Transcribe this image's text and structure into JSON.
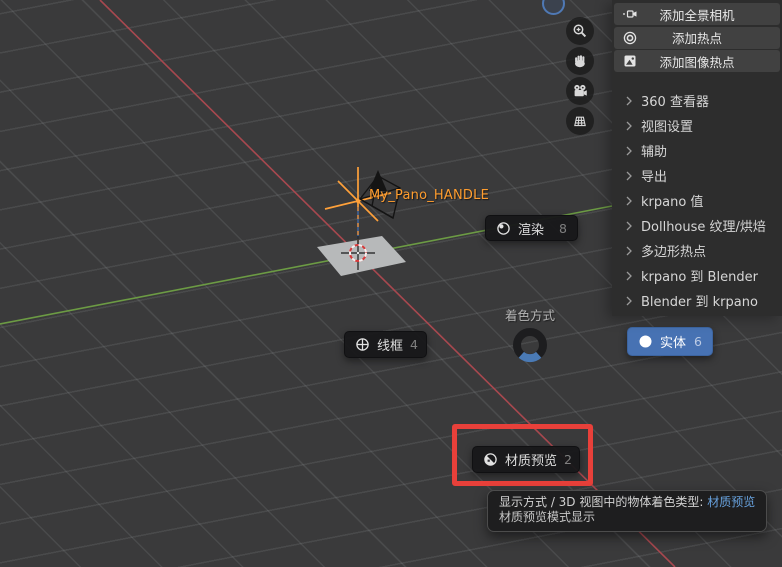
{
  "colors": {
    "accent_blue": "#4772b3",
    "annotation_red": "#e8403a",
    "object_orange": "#ff9d2e",
    "axis_red": "#a8484f",
    "axis_green": "#6c9b44"
  },
  "viewport": {
    "object_label": "My_Pano_HANDLE",
    "toolbar": [
      {
        "name": "zoom-in"
      },
      {
        "name": "pan"
      },
      {
        "name": "camera-view"
      },
      {
        "name": "toggle-orthographic"
      }
    ]
  },
  "pie_menu": {
    "title": "着色方式",
    "items": [
      {
        "label": "渲染",
        "shortcut": "8",
        "direction": "top"
      },
      {
        "label": "线框",
        "shortcut": "4",
        "direction": "left"
      },
      {
        "label": "实体",
        "shortcut": "6",
        "direction": "right",
        "selected": true
      },
      {
        "label": "材质预览",
        "shortcut": "2",
        "direction": "bottom",
        "annotated": true
      }
    ]
  },
  "panel": {
    "buttons": [
      {
        "label": "添加全景相机"
      },
      {
        "label": "添加热点"
      },
      {
        "label": "添加图像热点"
      }
    ],
    "sections": [
      {
        "label": "360 查看器"
      },
      {
        "label": "视图设置"
      },
      {
        "label": "辅助"
      },
      {
        "label": "导出"
      },
      {
        "label": "krpano 值"
      },
      {
        "label": "Dollhouse 纹理/烘焙"
      },
      {
        "label": "多边形热点"
      },
      {
        "label": "krpano 到 Blender"
      },
      {
        "label": "Blender 到 krpano"
      }
    ]
  },
  "tooltip": {
    "line1_label": "显示方式 / 3D 视图中的物体着色类型: ",
    "line1_value": "材质预览",
    "line2": "材质预览模式显示"
  }
}
